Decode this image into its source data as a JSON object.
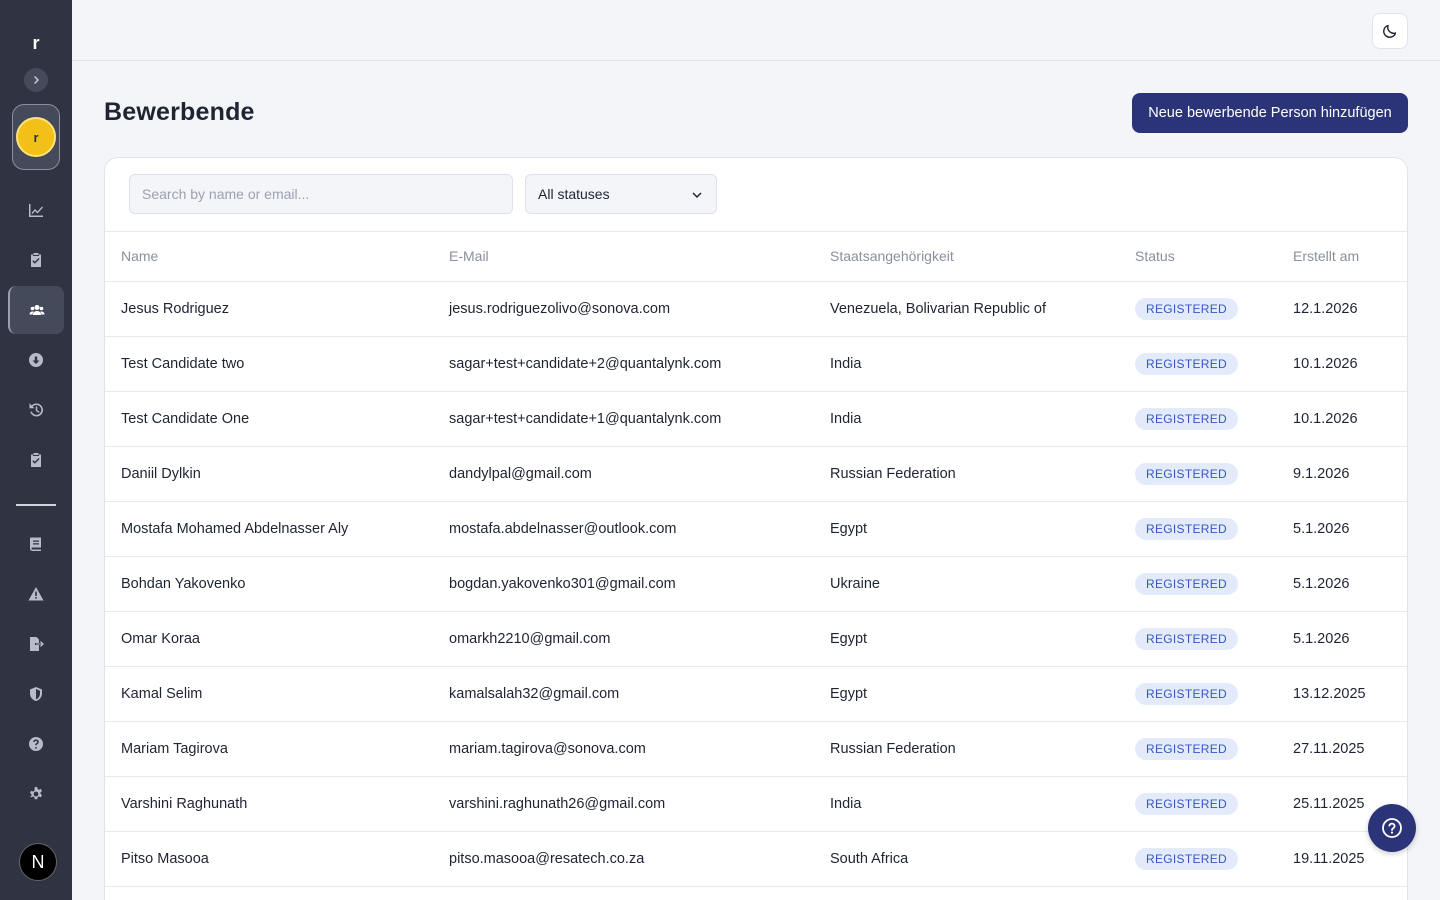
{
  "sidebar": {
    "brand": "r",
    "org_initial": "r",
    "user_initial": "N",
    "nav_top": [
      {
        "icon": "chart-line-icon",
        "active": false
      },
      {
        "icon": "clipboard-check-icon",
        "active": false
      },
      {
        "icon": "users-icon",
        "active": true
      },
      {
        "icon": "download-circle-icon",
        "active": false
      },
      {
        "icon": "history-icon",
        "active": false
      },
      {
        "icon": "clipboard-check-icon",
        "active": false
      }
    ],
    "nav_bottom": [
      {
        "icon": "book-icon"
      },
      {
        "icon": "warning-icon"
      },
      {
        "icon": "file-export-icon"
      },
      {
        "icon": "shield-icon"
      },
      {
        "icon": "question-circle-icon"
      },
      {
        "icon": "gear-icon"
      }
    ]
  },
  "header": {
    "title": "Bewerbende",
    "add_button": "Neue bewerbende Person hinzufügen"
  },
  "filters": {
    "search_placeholder": "Search by name or email...",
    "status_value": "All statuses"
  },
  "table": {
    "columns": [
      "Name",
      "E-Mail",
      "Staatsangehörigkeit",
      "Status",
      "Erstellt am"
    ],
    "rows": [
      {
        "name": "Jesus Rodriguez",
        "email": "jesus.rodriguezolivo@sonova.com",
        "nationality": "Venezuela, Bolivarian Republic of",
        "status": "REGISTERED",
        "created": "12.1.2026"
      },
      {
        "name": "Test Candidate two",
        "email": "sagar+test+candidate+2@quantalynk.com",
        "nationality": "India",
        "status": "REGISTERED",
        "created": "10.1.2026"
      },
      {
        "name": "Test Candidate One",
        "email": "sagar+test+candidate+1@quantalynk.com",
        "nationality": "India",
        "status": "REGISTERED",
        "created": "10.1.2026"
      },
      {
        "name": "Daniil Dylkin",
        "email": "dandylpal@gmail.com",
        "nationality": "Russian Federation",
        "status": "REGISTERED",
        "created": "9.1.2026"
      },
      {
        "name": "Mostafa Mohamed Abdelnasser Aly",
        "email": "mostafa.abdelnasser@outlook.com",
        "nationality": "Egypt",
        "status": "REGISTERED",
        "created": "5.1.2026"
      },
      {
        "name": "Bohdan Yakovenko",
        "email": "bogdan.yakovenko301@gmail.com",
        "nationality": "Ukraine",
        "status": "REGISTERED",
        "created": "5.1.2026"
      },
      {
        "name": "Omar Koraa",
        "email": "omarkh2210@gmail.com",
        "nationality": "Egypt",
        "status": "REGISTERED",
        "created": "5.1.2026"
      },
      {
        "name": "Kamal Selim",
        "email": "kamalsalah32@gmail.com",
        "nationality": "Egypt",
        "status": "REGISTERED",
        "created": "13.12.2025"
      },
      {
        "name": "Mariam Tagirova",
        "email": "mariam.tagirova@sonova.com",
        "nationality": "Russian Federation",
        "status": "REGISTERED",
        "created": "27.11.2025"
      },
      {
        "name": "Varshini Raghunath",
        "email": "varshini.raghunath26@gmail.com",
        "nationality": "India",
        "status": "REGISTERED",
        "created": "25.11.2025"
      },
      {
        "name": "Pitso Masooa",
        "email": "pitso.masooa@resatech.co.za",
        "nationality": "South Africa",
        "status": "REGISTERED",
        "created": "19.11.2025"
      }
    ]
  },
  "colors": {
    "sidebar_bg": "#2f3342",
    "primary": "#2b3478",
    "badge_bg": "#e3ebfb",
    "badge_text": "#3756c4",
    "page_bg": "#f4f5f8"
  }
}
